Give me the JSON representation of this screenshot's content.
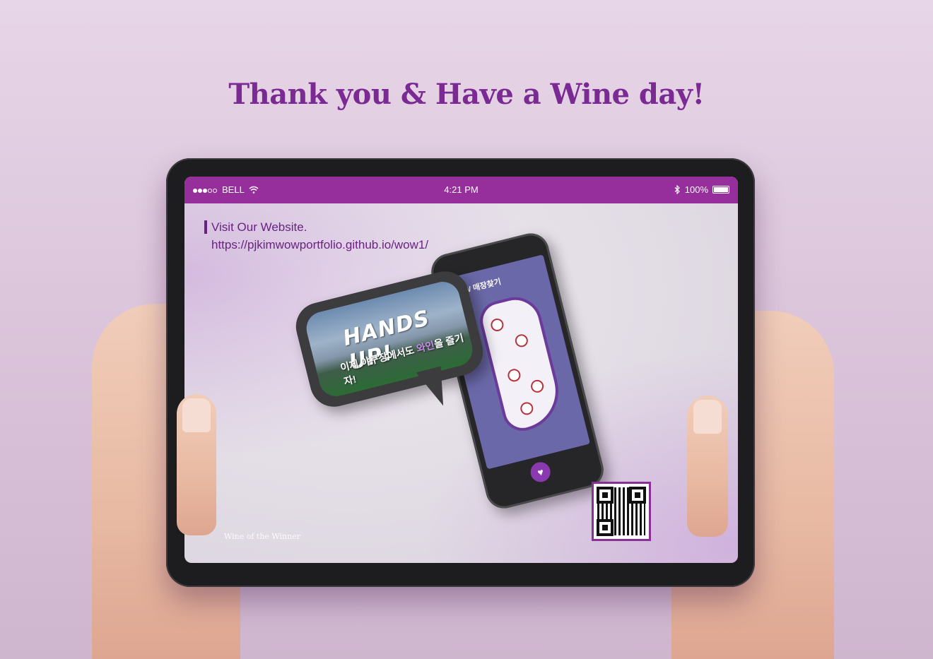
{
  "headline": "Thank you & Have a Wine day!",
  "status_bar": {
    "carrier": "BELL",
    "time": "4:21 PM",
    "battery": "100%"
  },
  "screen": {
    "visit_label": "Visit Our Website.",
    "url": "https://pjkimwowportfolio.github.io/wow1/",
    "brand": "Wine of the Winner"
  },
  "phone": {
    "title": "WOW 매장찾기"
  },
  "bubble": {
    "headline": "HANDS UP!",
    "subtitle_pre": "이제 야구장에서도 ",
    "subtitle_highlight": "와인",
    "subtitle_post": "을 즐기자!"
  },
  "colors": {
    "accent": "#7b2a94",
    "status_bar": "#962e9b"
  },
  "icons": [
    "signal-dots-icon",
    "wifi-icon",
    "bluetooth-icon",
    "battery-icon",
    "location-pin-icon",
    "qr-code-icon",
    "heart-hand-icon"
  ]
}
